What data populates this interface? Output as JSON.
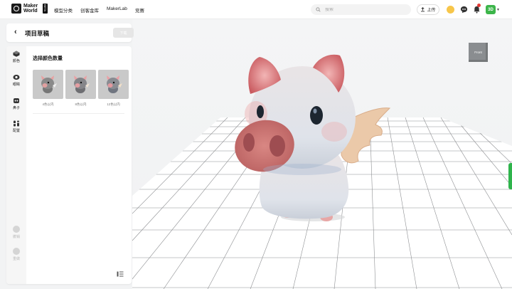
{
  "brand": {
    "line1": "Maker",
    "line2": "World",
    "badge": "BETA"
  },
  "nav": [
    "模型分类",
    "创客金库",
    "MakerLab",
    "竞赛"
  ],
  "search": {
    "placeholder": "搜索"
  },
  "upload": {
    "label": "上传"
  },
  "user": {
    "avatar_text": "3D"
  },
  "icons": {
    "coin": "coin-icon",
    "chat": "chat-icon",
    "bell": "bell-icon"
  },
  "colors": {
    "accent_green": "#2fb44c",
    "notification": "#e53935",
    "coin": "#f7c64a"
  },
  "header": {
    "title": "项目草稿",
    "next_label": "下载"
  },
  "viewport": {
    "view_cube_label": "Front"
  },
  "rail": {
    "items": [
      {
        "label": "颜色",
        "icon": "color-icon"
      },
      {
        "label": "眼睛",
        "icon": "eye-icon"
      },
      {
        "label": "鼻子",
        "icon": "nose-icon"
      },
      {
        "label": "配置",
        "icon": "config-icon"
      }
    ],
    "bottom_items": [
      {
        "label": "撤销",
        "icon": "undo-icon"
      },
      {
        "label": "重做",
        "icon": "redo-icon"
      }
    ]
  },
  "color_section": {
    "title": "选择颜色数量",
    "options": [
      {
        "label": "4色以内"
      },
      {
        "label": "8色以内"
      },
      {
        "label": "12色以内"
      }
    ]
  }
}
